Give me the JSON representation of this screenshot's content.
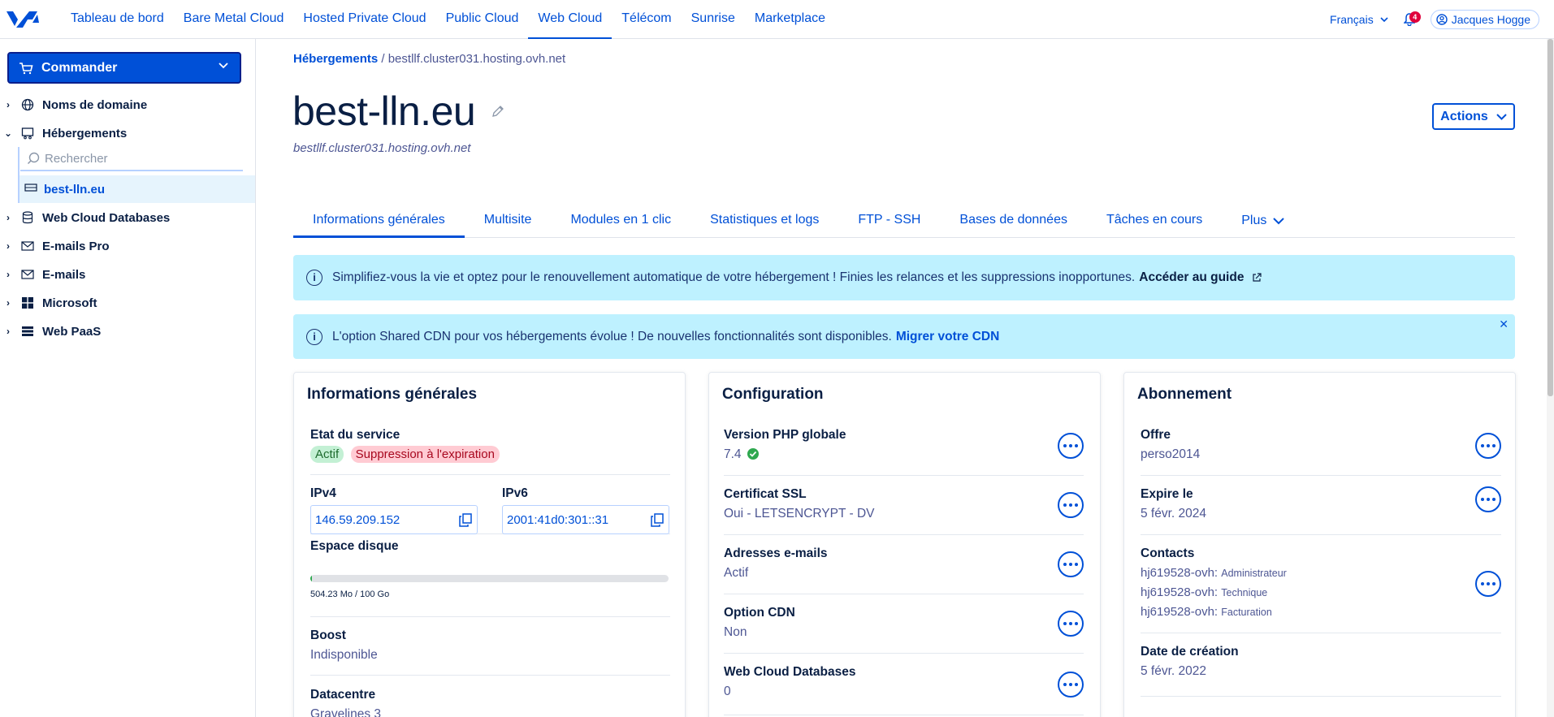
{
  "topnav": {
    "items": [
      "Tableau de bord",
      "Bare Metal Cloud",
      "Hosted Private Cloud",
      "Public Cloud",
      "Web Cloud",
      "Télécom",
      "Sunrise",
      "Marketplace"
    ],
    "active_index": 4,
    "language": "Français",
    "notifications_count": "4",
    "user_name": "Jacques Hogge"
  },
  "sidebar": {
    "order_button": "Commander",
    "items": [
      {
        "label": "Noms de domaine",
        "icon": "globe-icon"
      },
      {
        "label": "Hébergements",
        "icon": "hosting-icon"
      },
      {
        "label": "Web Cloud Databases",
        "icon": "database-icon"
      },
      {
        "label": "E-mails Pro",
        "icon": "mail-icon"
      },
      {
        "label": "E-mails",
        "icon": "mail-icon"
      },
      {
        "label": "Microsoft",
        "icon": "windows-icon"
      },
      {
        "label": "Web PaaS",
        "icon": "stack-icon"
      }
    ],
    "search_placeholder": "Rechercher",
    "selected_sub": "best-lln.eu"
  },
  "breadcrumb": {
    "root": "Hébergements",
    "separator": "/",
    "current": "bestllf.cluster031.hosting.ovh.net"
  },
  "page": {
    "title": "best-lln.eu",
    "subtitle": "bestllf.cluster031.hosting.ovh.net",
    "actions_label": "Actions"
  },
  "tabs": [
    "Informations générales",
    "Multisite",
    "Modules en 1 clic",
    "Statistiques et logs",
    "FTP - SSH",
    "Bases de données",
    "Tâches en cours",
    "Plus"
  ],
  "banners": [
    {
      "text": "Simplifiez-vous la vie et optez pour le renouvellement automatique de votre hébergement ! Finies les relances et les suppressions inopportunes.",
      "link": "Accéder au guide"
    },
    {
      "text": "L'option Shared CDN pour vos hébergements évolue ! De nouvelles fonctionnalités sont disponibles.",
      "link": "Migrer votre CDN"
    }
  ],
  "general": {
    "title": "Informations générales",
    "state_label": "Etat du service",
    "state_active": "Actif",
    "state_expiry": "Suppression à l'expiration",
    "ipv4_label": "IPv4",
    "ipv4": "146.59.209.152",
    "ipv6_label": "IPv6",
    "ipv6": "2001:41d0:301::31",
    "disk_label": "Espace disque",
    "disk_text": "504.23 Mo / 100 Go",
    "disk_fraction": 0.005,
    "boost_label": "Boost",
    "boost_value": "Indisponible",
    "dc_label": "Datacentre",
    "dc_value": "Gravelines 3"
  },
  "configuration": {
    "title": "Configuration",
    "rows": [
      {
        "label": "Version PHP globale",
        "value": "7.4"
      },
      {
        "label": "Certificat SSL",
        "value": "Oui - LETSENCRYPT - DV"
      },
      {
        "label": "Adresses e-mails",
        "value": "Actif"
      },
      {
        "label": "Option CDN",
        "value": "Non"
      },
      {
        "label": "Web Cloud Databases",
        "value": "0"
      }
    ]
  },
  "subscription": {
    "title": "Abonnement",
    "offer_label": "Offre",
    "offer_value": "perso2014",
    "expire_label": "Expire le",
    "expire_value": "5 févr. 2024",
    "contacts_label": "Contacts",
    "contacts": [
      {
        "id": "hj619528-ovh:",
        "role": "Administrateur"
      },
      {
        "id": "hj619528-ovh:",
        "role": "Technique"
      },
      {
        "id": "hj619528-ovh:",
        "role": "Facturation"
      }
    ],
    "created_label": "Date de création",
    "created_value": "5 févr. 2022"
  },
  "colors": {
    "accent": "#0050d7",
    "navy": "#0a1f44",
    "banner": "#bef1ff",
    "success": "#2fa84f"
  }
}
